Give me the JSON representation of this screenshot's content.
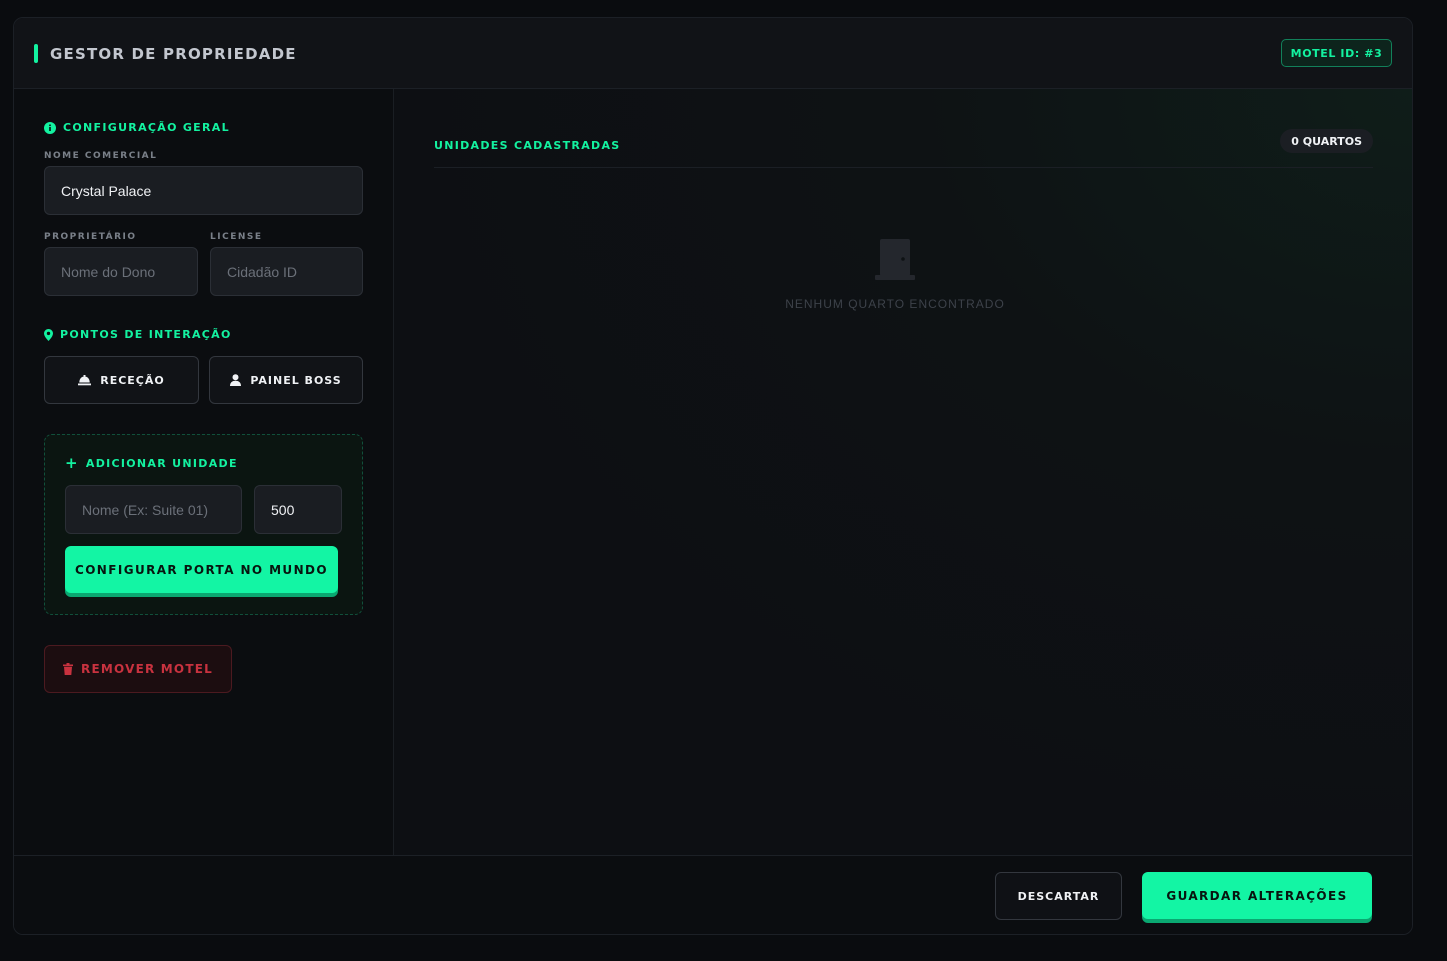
{
  "header": {
    "title": "GESTOR DE PROPRIEDADE",
    "motel_id": "MOTEL ID: #3"
  },
  "sidebar": {
    "general": {
      "title": "CONFIGURAÇÃO GERAL",
      "name_label": "NOME COMERCIAL",
      "name_value": "Crystal Palace",
      "owner_label": "PROPRIETÁRIO",
      "owner_placeholder": "Nome do Dono",
      "license_label": "LICENSE",
      "license_placeholder": "Cidadão ID"
    },
    "interaction": {
      "title": "PONTOS DE INTERAÇÃO",
      "reception_label": "RECEÇÃO",
      "boss_label": "PAINEL BOSS"
    },
    "add_unit": {
      "title": "ADICIONAR UNIDADE",
      "name_placeholder": "Nome (Ex: Suite 01)",
      "price_value": "500",
      "configure_label": "CONFIGURAR PORTA NO MUNDO"
    },
    "remove_label": "REMOVER MOTEL"
  },
  "main": {
    "units_title": "UNIDADES CADASTRADAS",
    "room_count": "0 QUARTOS",
    "empty_text": "NENHUM QUARTO ENCONTRADO"
  },
  "footer": {
    "discard_label": "DESCARTAR",
    "save_label": "GUARDAR ALTERAÇÕES"
  },
  "colors": {
    "accent": "#13f2a0",
    "danger": "#c8323f",
    "background": "#0d0f13"
  },
  "icons": {
    "general": "info-circle-icon",
    "interaction": "map-pin-icon",
    "reception": "bell-icon",
    "boss": "user-icon",
    "add": "plus-icon",
    "remove": "trash-icon",
    "empty": "door-icon"
  }
}
